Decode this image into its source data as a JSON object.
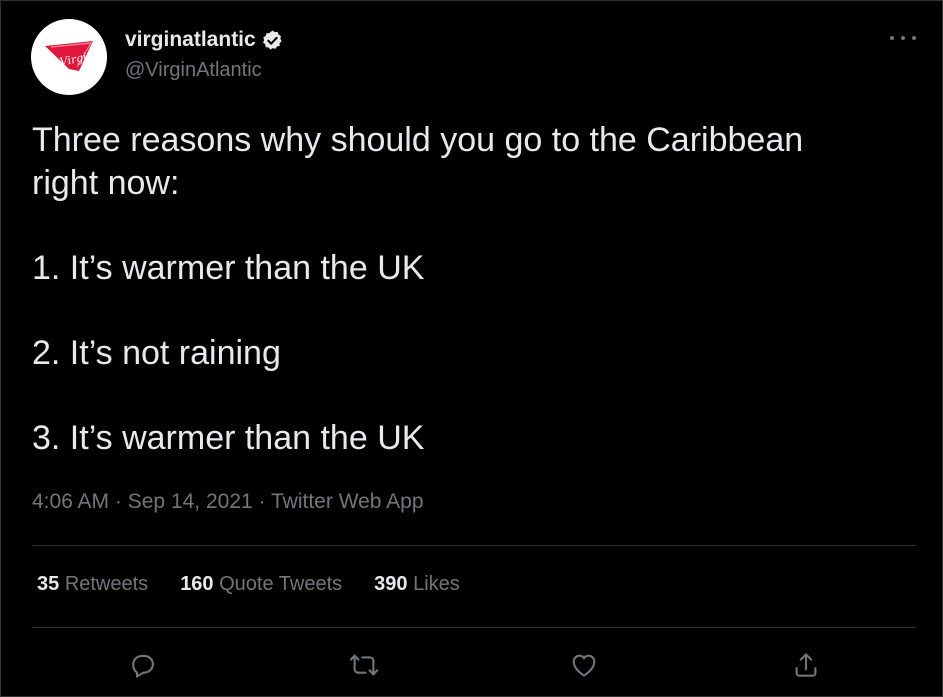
{
  "tweet": {
    "author": {
      "display_name": "virginatlantic",
      "handle": "@VirginAtlantic",
      "avatar_logo_text": "Virgin",
      "verified": true
    },
    "text_lines": [
      "Three reasons why should you go to the Caribbean right now:",
      "1. It’s warmer than the UK",
      "2. It’s not raining",
      "3. It’s warmer than the UK"
    ],
    "time": "4:06 AM",
    "separator": "·",
    "date": "Sep 14, 2021",
    "source": "Twitter Web App",
    "stats": {
      "retweets_count": "35",
      "retweets_label": "Retweets",
      "quote_count": "160",
      "quote_label": "Quote Tweets",
      "likes_count": "390",
      "likes_label": "Likes"
    },
    "actions": {
      "reply_icon": "reply-icon",
      "retweet_icon": "retweet-icon",
      "like_icon": "like-icon",
      "share_icon": "share-icon"
    }
  },
  "colors": {
    "background": "#000000",
    "text_primary": "#e7e9ea",
    "text_secondary": "#71767b",
    "divider": "#2f3336",
    "brand_red": "#e1163c"
  }
}
